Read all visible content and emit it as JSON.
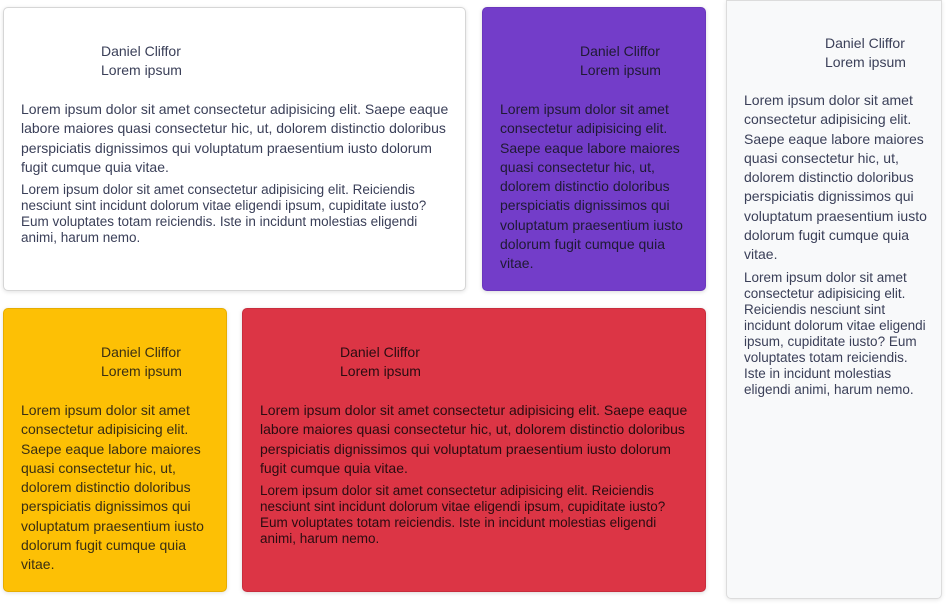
{
  "cards": [
    {
      "id": "white",
      "author": "Daniel Cliffor",
      "subtitle": "Lorem ipsum",
      "paragraph1": "Lorem ipsum dolor sit amet consectetur adipisicing elit. Saepe eaque labore maiores quasi consectetur hic, ut, dolorem distinctio doloribus perspiciatis dignissimos qui voluptatum praesentium iusto dolorum fugit cumque quia vitae.",
      "paragraph2": "Lorem ipsum dolor sit amet consectetur adipisicing elit. Reiciendis nesciunt sint incidunt dolorum vitae eligendi ipsum, cupiditate iusto? Eum voluptates totam reiciendis. Iste in incidunt molestias eligendi animi, harum nemo.",
      "background": "#ffffff"
    },
    {
      "id": "purple",
      "author": "Daniel Cliffor",
      "subtitle": "Lorem ipsum",
      "paragraph1": "Lorem ipsum dolor sit amet consectetur adipisicing elit. Saepe eaque labore maiores quasi consectetur hic, ut, dolorem distinctio doloribus perspiciatis dignissimos qui voluptatum praesentium iusto dolorum fugit cumque quia vitae.",
      "background": "#733dc9"
    },
    {
      "id": "gray",
      "author": "Daniel Cliffor",
      "subtitle": "Lorem ipsum",
      "paragraph1": "Lorem ipsum dolor sit amet consectetur adipisicing elit. Saepe eaque labore maiores quasi consectetur hic, ut, dolorem distinctio doloribus perspiciatis dignissimos qui voluptatum praesentium iusto dolorum fugit cumque quia vitae.",
      "paragraph2": "Lorem ipsum dolor sit amet consectetur adipisicing elit. Reiciendis nesciunt sint incidunt dolorum vitae eligendi ipsum, cupiditate iusto? Eum voluptates totam reiciendis. Iste in incidunt molestias eligendi animi, harum nemo.",
      "background": "#f8f9fa"
    },
    {
      "id": "yellow",
      "author": "Daniel Cliffor",
      "subtitle": "Lorem ipsum",
      "paragraph1": "Lorem ipsum dolor sit amet consectetur adipisicing elit. Saepe eaque labore maiores quasi consectetur hic, ut, dolorem distinctio doloribus perspiciatis dignissimos qui voluptatum praesentium iusto dolorum fugit cumque quia vitae.",
      "background": "#fdc005"
    },
    {
      "id": "red",
      "author": "Daniel Cliffor",
      "subtitle": "Lorem ipsum",
      "paragraph1": "Lorem ipsum dolor sit amet consectetur adipisicing elit. Saepe eaque labore maiores quasi consectetur hic, ut, dolorem distinctio doloribus perspiciatis dignissimos qui voluptatum praesentium iusto dolorum fugit cumque quia vitae.",
      "paragraph2": "Lorem ipsum dolor sit amet consectetur adipisicing elit. Reiciendis nesciunt sint incidunt dolorum vitae eligendi ipsum, cupiditate iusto? Eum voluptates totam reiciendis. Iste in incidunt molestias eligendi animi, harum nemo.",
      "background": "#dc3545"
    }
  ]
}
